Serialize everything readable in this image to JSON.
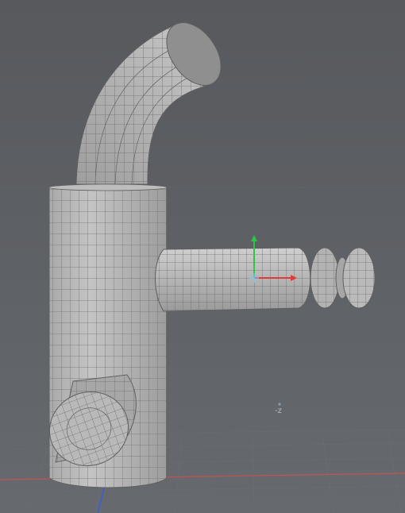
{
  "viewport": {
    "axis_label": "-z",
    "background_color": "#5d6064",
    "mesh_fill_color": "#b4b4b4",
    "wire_color": "#6b6b6b",
    "gizmo": {
      "x_axis_color": "#e03a3a",
      "y_axis_color": "#2ec44a",
      "z_axis_color": "#3a5be0",
      "pivot_color": "#6fc6ff"
    },
    "ground_line_color": "#c45252"
  }
}
